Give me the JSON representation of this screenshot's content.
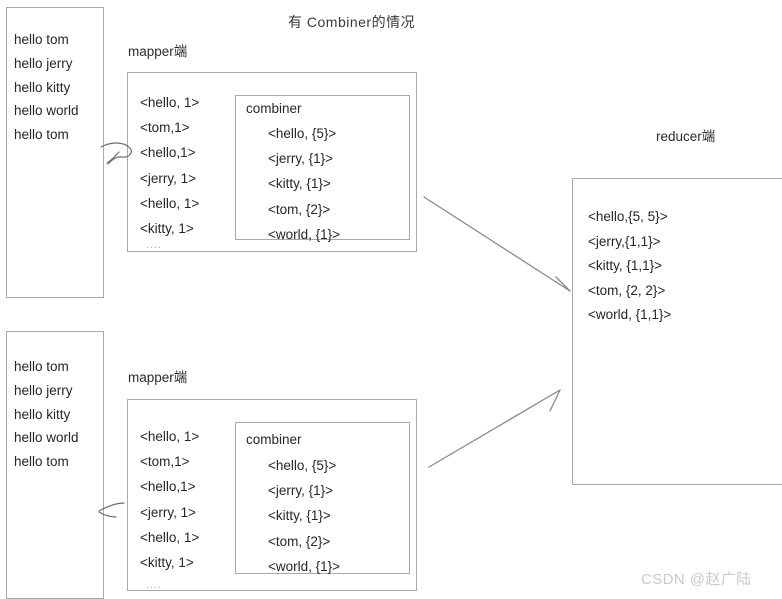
{
  "page": {
    "title": "有 Combiner的情况",
    "background_color": "#ffffff",
    "stroke_color": "#a9a9a9",
    "text_color": "#262626",
    "watermark": "CSDN @赵广陆"
  },
  "stage_labels": {
    "mapper_1": "mapper端",
    "mapper_2": "mapper端",
    "reducer": "reducer端"
  },
  "inputs": [
    {
      "name": "input-split-1",
      "lines": [
        "hello tom",
        "hello jerry",
        "hello kitty",
        "hello world",
        "hello tom"
      ]
    },
    {
      "name": "input-split-2",
      "lines": [
        "hello tom",
        "hello jerry",
        "hello kitty",
        "hello world",
        "hello tom"
      ]
    }
  ],
  "mappers": [
    {
      "name": "mapper-1",
      "pairs": [
        "<hello, 1>",
        "<tom,1>",
        "<hello,1>",
        "<jerry, 1>",
        "<hello, 1>",
        "<kitty, 1>"
      ],
      "ellipsis": "....",
      "combiner": {
        "label": "combiner",
        "pairs": [
          "<hello, {5}>",
          "<jerry, {1}>",
          "<kitty, {1}>",
          "<tom, {2}>",
          "<world, {1}>"
        ]
      }
    },
    {
      "name": "mapper-2",
      "pairs": [
        "<hello, 1>",
        "<tom,1>",
        "<hello,1>",
        "<jerry, 1>",
        "<hello, 1>",
        "<kitty, 1>"
      ],
      "ellipsis": "....",
      "combiner": {
        "label": "combiner",
        "pairs": [
          "<hello, {5}>",
          "<jerry, {1}>",
          "<kitty, {1}>",
          "<tom, {2}>",
          "<world, {1}>"
        ]
      }
    }
  ],
  "reducer": {
    "name": "reducer-output",
    "pairs": [
      "<hello,{5, 5}>",
      "<jerry,{1,1}>",
      "<kitty, {1,1}>",
      "<tom, {2, 2}>",
      "<world, {1,1}>"
    ]
  }
}
